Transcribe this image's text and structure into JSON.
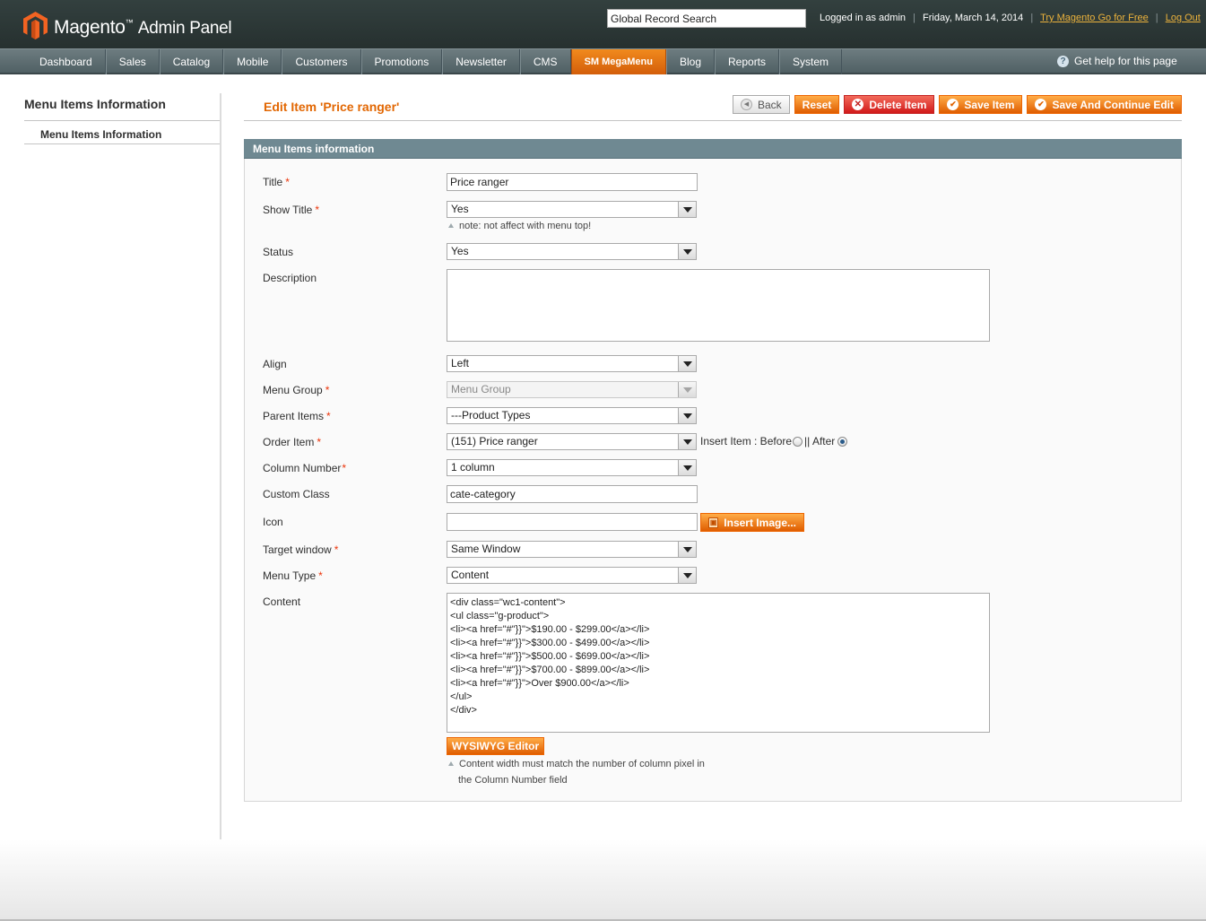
{
  "header": {
    "brand_main": "Magento",
    "brand_tm": "™",
    "brand_sub": "Admin Panel",
    "search_value": "Global Record Search",
    "logged_in": "Logged in as admin",
    "date": "Friday, March 14, 2014",
    "try_link": "Try Magento Go for Free",
    "logout": "Log Out",
    "separator": "|"
  },
  "nav": {
    "items": [
      "Dashboard",
      "Sales",
      "Catalog",
      "Mobile",
      "Customers",
      "Promotions",
      "Newsletter",
      "CMS",
      "SM MegaMenu",
      "Blog",
      "Reports",
      "System"
    ],
    "active_index": 8,
    "help": "Get help for this page",
    "help_icon": "?"
  },
  "sidebar": {
    "title": "Menu Items Information",
    "tab": "Menu Items Information"
  },
  "page": {
    "title": "Edit Item 'Price ranger'"
  },
  "buttons": {
    "back": "Back",
    "reset": "Reset",
    "delete": "Delete Item",
    "save": "Save Item",
    "save_continue": "Save And Continue Edit",
    "insert_image": "Insert Image...",
    "wysiwyg": "WYSIWYG Editor"
  },
  "form": {
    "section_title": "Menu Items information",
    "required_mark": "*",
    "title_label": "Title",
    "title_value": "Price ranger",
    "show_title_label": "Show Title",
    "show_title_value": "Yes",
    "show_title_note": "note: not affect with menu top!",
    "status_label": "Status",
    "status_value": "Yes",
    "description_label": "Description",
    "description_value": "",
    "align_label": "Align",
    "align_value": "Left",
    "menu_group_label": "Menu Group",
    "menu_group_value": "Menu Group",
    "parent_items_label": "Parent Items",
    "parent_items_value": "---Product Types",
    "order_item_label": "Order Item",
    "order_item_value": "(151) Price ranger",
    "insert_item_label": "Insert Item : Before",
    "insert_item_sep": "|| After",
    "insert_position": "After",
    "column_number_label": "Column Number",
    "column_number_value": "1 column",
    "custom_class_label": "Custom Class",
    "custom_class_value": "cate-category",
    "icon_label": "Icon",
    "icon_value": "",
    "target_window_label": "Target window",
    "target_window_value": "Same Window",
    "menu_type_label": "Menu Type",
    "menu_type_value": "Content",
    "content_label": "Content",
    "content_value": "<div class=\"wc1-content\">\n<ul class=\"g-product\">\n<li><a href=\"#\"}}\">$190.00 - $299.00</a></li>\n<li><a href=\"#\"}}\">$300.00 - $499.00</a></li>\n<li><a href=\"#\"}}\">$500.00 - $699.00</a></li>\n<li><a href=\"#\"}}\">$700.00 - $899.00</a></li>\n<li><a href=\"#\"}}\">Over $900.00</a></li>\n</ul>\n</div>",
    "content_note_1": "Content width must match the number of column pixel in",
    "content_note_2": "the Column Number field"
  }
}
